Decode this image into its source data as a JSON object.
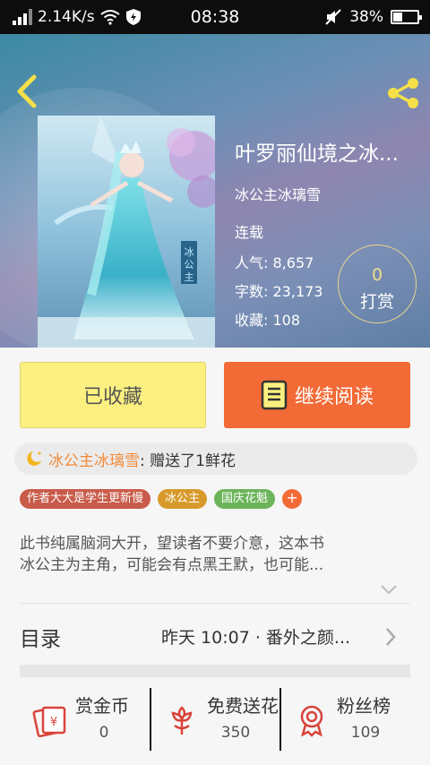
{
  "status_bar": {
    "network_speed": "2.14K/s",
    "time": "08:38",
    "battery": "38%",
    "battery_level": 0.38,
    "icons": [
      "signal-icon",
      "wifi-icon",
      "shield-icon",
      "mute-icon",
      "battery-icon"
    ]
  },
  "book": {
    "title": "叶罗丽仙境之冰...",
    "author": "冰公主冰璃雪",
    "status": "连载",
    "popularity_label": "人气:",
    "popularity": "8,657",
    "words_label": "字数:",
    "words": "23,173",
    "collect_label": "收藏:",
    "collect": "108",
    "cover_text": "冰公主"
  },
  "tip": {
    "count": "0",
    "label": "打赏"
  },
  "actions": {
    "collected_label": "已收藏",
    "read_label": "继续阅读"
  },
  "gift": {
    "user": "冰公主冰璃雪",
    "text": ": 赠送了1鲜花"
  },
  "tags": [
    {
      "label": "作者大大是学生更新慢",
      "color": "#c95b4a"
    },
    {
      "label": "冰公主",
      "color": "#d79a2b"
    },
    {
      "label": "国庆花魁",
      "color": "#6cb45a"
    }
  ],
  "tag_add": "+",
  "description": {
    "line1": "此书纯属脑洞大开，望读者不要介意，这本书",
    "line2": "冰公主为主角，可能会有点黑王默，也可能..."
  },
  "toc": {
    "label": "目录",
    "latest": "昨天 10:07 · 番外之颜..."
  },
  "bottom": [
    {
      "label": "赏金币",
      "value": "0",
      "icon": "red-envelope-icon"
    },
    {
      "label": "免费送花",
      "value": "350",
      "icon": "flower-icon"
    },
    {
      "label": "粉丝榜",
      "value": "109",
      "icon": "medal-icon"
    }
  ],
  "colors": {
    "accent": "#f26a35",
    "collected_bg": "#fbf080",
    "icon_red": "#d9433a",
    "gift_user": "#f08a3a"
  }
}
